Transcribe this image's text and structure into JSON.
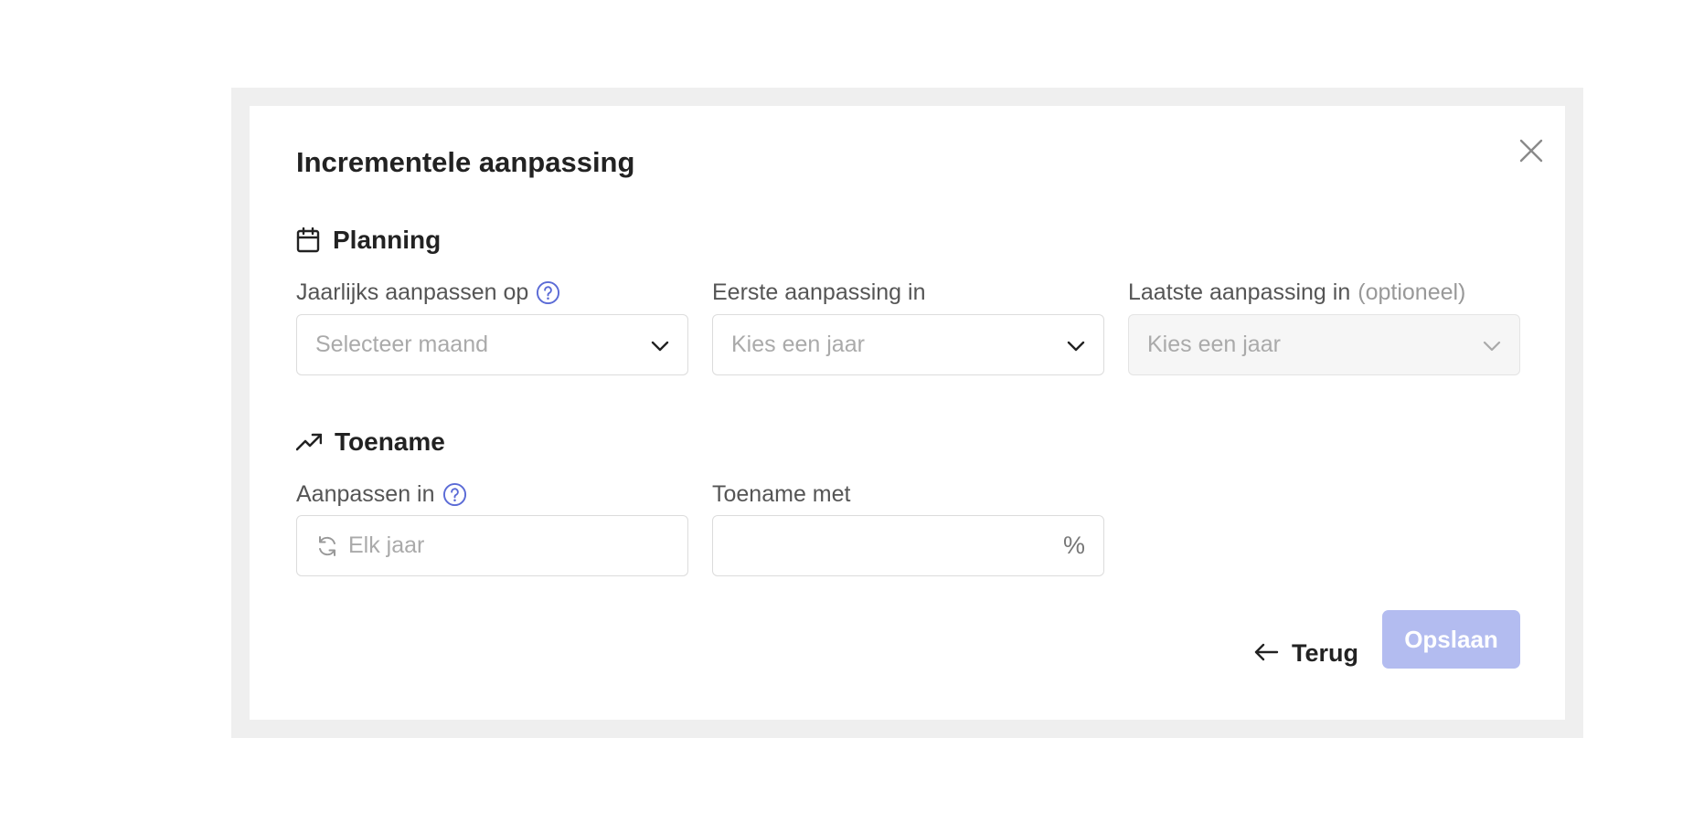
{
  "modal": {
    "title": "Incrementele aanpassing",
    "close_icon": "close-icon"
  },
  "planning": {
    "heading": "Planning",
    "icon": "calendar-icon",
    "fields": [
      {
        "label": "Jaarlijks aanpassen op",
        "optional": "",
        "help_icon": "question-circle-icon",
        "placeholder": "Selecteer maand",
        "disabled": false
      },
      {
        "label": "Eerste aanpassing in",
        "optional": "",
        "placeholder": "Kies een jaar",
        "disabled": false
      },
      {
        "label": "Laatste aanpassing in",
        "optional": "(optioneel)",
        "placeholder": "Kies een jaar",
        "disabled": true
      }
    ]
  },
  "toename": {
    "heading": "Toename",
    "icon": "trending-up-icon",
    "fields": [
      {
        "label": "Aanpassen in",
        "help_icon": "question-circle-icon",
        "icon": "refresh-icon",
        "value": "Elk jaar"
      },
      {
        "label": "Toename met",
        "value": "",
        "suffix": "%"
      }
    ]
  },
  "footer": {
    "back_label": "Terug",
    "back_icon": "arrow-left-icon",
    "save_label": "Opslaan"
  },
  "colors": {
    "accent": "#5b6bd6",
    "save_disabled_bg": "#b3bcf0",
    "backdrop": "#efefef"
  }
}
